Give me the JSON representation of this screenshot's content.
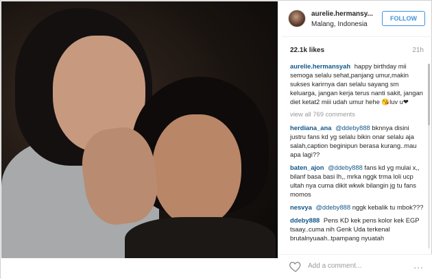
{
  "post": {
    "username": "aurelie.hermansy...",
    "location": "Malang, Indonesia",
    "follow_label": "FOLLOW",
    "likes": "22.1k likes",
    "time": "21h",
    "caption": {
      "user": "aurelie.hermansyah",
      "text": "happy birthday mii semoga selalu sehat,panjang umur,makin sukses karirnya dan selalu sayang sm keluarga, jangan kerja terus nanti sakit, jangan diet ketat2 miii udah umur hehe 😘luv u❤"
    },
    "view_all": "view all 769 comments",
    "comments": [
      {
        "user": "herdiana_ana",
        "mention": "@ddeby888",
        "text": "bknnya disini justru fans kd yg selalu bikin onar selalu aja salah,caption beginipun berasa kurang..mau apa lagi??"
      },
      {
        "user": "baten_ajon",
        "mention": "@ddeby888",
        "text": "fans kd yg mulai x,, bilanf basa basi lh,, mrka nggk trma loli ucp ultah nya cuma dikit wkwk bilangin jg tu fans momos"
      },
      {
        "user": "nesvya",
        "mention": "@ddeby888",
        "text": "nggk kebalik tu mbok???"
      },
      {
        "user": "ddeby888",
        "mention": "",
        "text": "Pens KD kek pens kolor kek EGP tsaay..cuma nih Genk Uda terkenal brutalnyuaah..tpampang nyuatah"
      }
    ],
    "add_comment_placeholder": "Add a comment...",
    "more_label": "...",
    "colors": {
      "link": "#125688",
      "follow": "#4090db",
      "muted": "#999999"
    }
  },
  "icons": {
    "heart": "heart-icon",
    "more": "more-options-icon"
  }
}
